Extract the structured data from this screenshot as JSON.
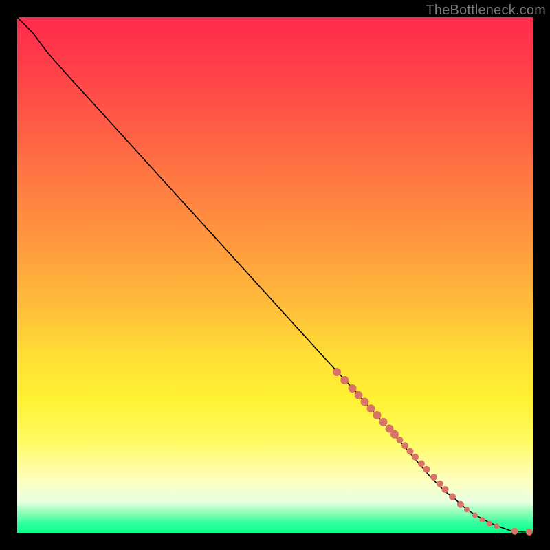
{
  "attribution": "TheBottleneck.com",
  "colors": {
    "background": "#000000",
    "gradient_top": "#ff2a4d",
    "gradient_mid1": "#ff9a3e",
    "gradient_mid2": "#ffe036",
    "gradient_bottom": "#0aff8a",
    "curve": "#000000",
    "marker": "#d87367"
  },
  "chart_data": {
    "type": "line",
    "title": "",
    "xlabel": "",
    "ylabel": "",
    "xlim": [
      0,
      100
    ],
    "ylim": [
      0,
      100
    ],
    "grid": false,
    "legend": false,
    "series": [
      {
        "name": "curve",
        "comment": "Monotonically decreasing curve from top-left to bottom-right; a slight kink near x≈6 then nearly linear descent; flattens at y≈0 near x≈96 and stays at 0 to x=100.",
        "x": [
          0,
          3,
          6,
          10,
          20,
          30,
          40,
          50,
          60,
          66,
          70,
          74,
          77,
          80,
          82,
          83,
          85,
          86,
          88,
          90,
          92,
          94,
          96,
          98,
          100
        ],
        "y": [
          100,
          97,
          93,
          88.5,
          77.5,
          66.5,
          55.5,
          44.5,
          33.5,
          27,
          22.5,
          18,
          14.5,
          11,
          9,
          8,
          6.5,
          5.5,
          4,
          2.8,
          1.8,
          1.0,
          0.3,
          0.15,
          0.15
        ]
      }
    ],
    "markers": {
      "comment": "Salmon-colored dots overlaid on the lower-right segment of the curve (roughly x ∈ [62, 100]). Two clusters: a dense run along the diagonal from ~x=62 to ~x=90, then a few sparse dots near the flat tail.",
      "points": [
        {
          "x": 62.0,
          "y": 31.2,
          "r": 6
        },
        {
          "x": 63.5,
          "y": 29.6,
          "r": 6
        },
        {
          "x": 65.0,
          "y": 28.0,
          "r": 6
        },
        {
          "x": 66.2,
          "y": 26.7,
          "r": 6
        },
        {
          "x": 67.4,
          "y": 25.4,
          "r": 6
        },
        {
          "x": 68.6,
          "y": 24.1,
          "r": 6
        },
        {
          "x": 69.8,
          "y": 22.8,
          "r": 6
        },
        {
          "x": 71.0,
          "y": 21.5,
          "r": 6
        },
        {
          "x": 72.2,
          "y": 20.2,
          "r": 6
        },
        {
          "x": 73.2,
          "y": 19.1,
          "r": 6
        },
        {
          "x": 74.2,
          "y": 18.0,
          "r": 5
        },
        {
          "x": 75.2,
          "y": 16.9,
          "r": 5
        },
        {
          "x": 76.2,
          "y": 15.8,
          "r": 5
        },
        {
          "x": 77.2,
          "y": 14.7,
          "r": 5
        },
        {
          "x": 78.4,
          "y": 13.4,
          "r": 5
        },
        {
          "x": 79.4,
          "y": 12.3,
          "r": 5
        },
        {
          "x": 80.8,
          "y": 10.8,
          "r": 5
        },
        {
          "x": 82.0,
          "y": 9.5,
          "r": 5
        },
        {
          "x": 83.0,
          "y": 8.4,
          "r": 5
        },
        {
          "x": 84.4,
          "y": 7.0,
          "r": 5
        },
        {
          "x": 86.0,
          "y": 5.5,
          "r": 5
        },
        {
          "x": 87.2,
          "y": 4.5,
          "r": 4
        },
        {
          "x": 88.8,
          "y": 3.4,
          "r": 4
        },
        {
          "x": 90.2,
          "y": 2.5,
          "r": 4
        },
        {
          "x": 91.6,
          "y": 1.8,
          "r": 4
        },
        {
          "x": 93.0,
          "y": 1.3,
          "r": 4
        },
        {
          "x": 96.5,
          "y": 0.3,
          "r": 5
        },
        {
          "x": 99.3,
          "y": 0.15,
          "r": 5
        }
      ]
    }
  }
}
